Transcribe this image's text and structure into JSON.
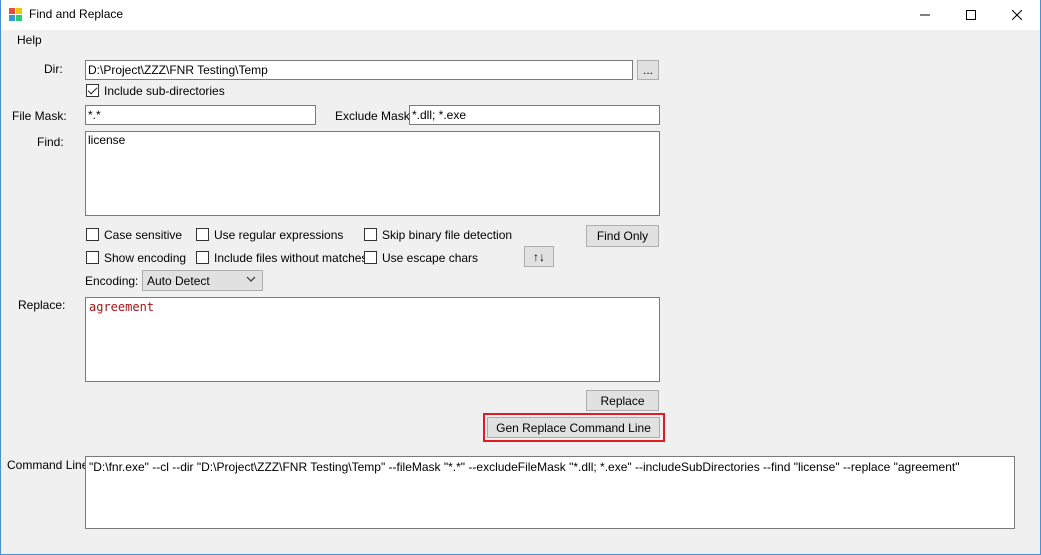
{
  "window": {
    "title": "Find and Replace",
    "minimize_icon": "minimize-icon",
    "maximize_icon": "maximize-icon",
    "close_icon": "close-icon"
  },
  "menu": {
    "help": "Help"
  },
  "dir": {
    "label": "Dir:",
    "value": "D:\\Project\\ZZZ\\FNR Testing\\Temp",
    "browse_label": "..."
  },
  "include_subdirs": {
    "label": "Include sub-directories",
    "checked": true
  },
  "file_mask": {
    "label": "File Mask:",
    "value": "*.*"
  },
  "exclude_mask": {
    "label": "Exclude Mask:",
    "value": "*.dll; *.exe"
  },
  "find": {
    "label": "Find:",
    "value": "license"
  },
  "options": {
    "case_sensitive": "Case sensitive",
    "use_regex": "Use regular expressions",
    "skip_binary": "Skip binary file detection",
    "show_encoding": "Show encoding",
    "include_no_matches": "Include files without matches",
    "use_escape": "Use escape chars"
  },
  "find_only_label": "Find Only",
  "swap_label": "↑↓",
  "encoding": {
    "label": "Encoding:",
    "value": "Auto Detect"
  },
  "replace": {
    "label": "Replace:",
    "value": "agreement"
  },
  "replace_button_label": "Replace",
  "gen_cmd_label": "Gen Replace Command Line",
  "command_line": {
    "label": "Command Line:",
    "value": "\"D:\\fnr.exe\" --cl --dir \"D:\\Project\\ZZZ\\FNR Testing\\Temp\" --fileMask \"*.*\" --excludeFileMask \"*.dll; *.exe\" --includeSubDirectories --find \"license\" --replace \"agreement\""
  },
  "colors": {
    "highlight": "#e11b22",
    "replace_text": "#a31515"
  }
}
